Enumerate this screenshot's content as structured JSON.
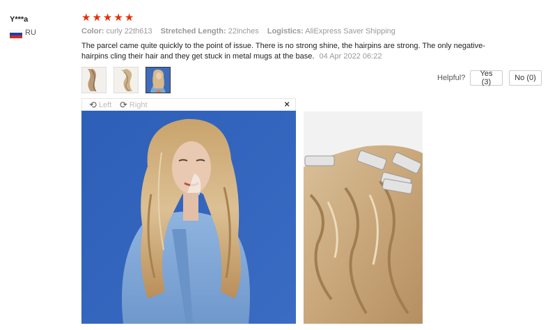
{
  "reviewer": {
    "name": "Y***a",
    "country": "RU",
    "flag_icon": "russia-flag-icon"
  },
  "rating": {
    "stars": 5,
    "color": "#e62e04"
  },
  "attributes": {
    "color_label": "Color:",
    "color_value": "curly 22th613",
    "length_label": "Stretched Length:",
    "length_value": "22inches",
    "logistics_label": "Logistics:",
    "logistics_value": "AliExpress Saver Shipping"
  },
  "review": {
    "text": "The parcel came quite quickly to the point of issue. There is no strong shine, the hairpins are strong. The only negative-hairpins cling their hair and they get stuck in metal mugs at the base.",
    "date": "04 Apr 2022 06:22"
  },
  "helpful": {
    "label": "Helpful?",
    "yes": "Yes (3)",
    "no": "No (0)"
  },
  "viewer": {
    "left_label": "Left",
    "right_label": "Right",
    "close_symbol": "×"
  },
  "colors": {
    "accent": "#f57224",
    "star": "#e62e04"
  }
}
